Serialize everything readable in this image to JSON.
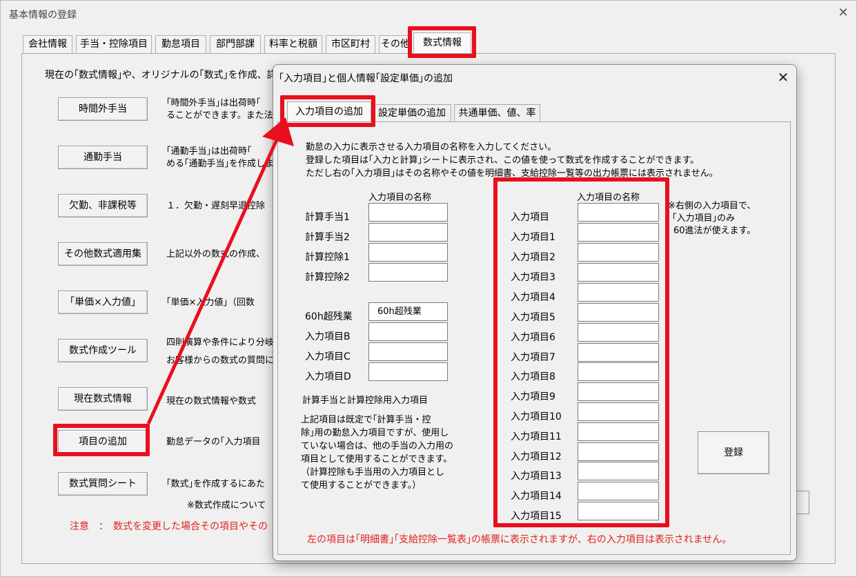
{
  "window": {
    "title": "基本情報の登録",
    "close": "✕"
  },
  "main_tabs": [
    "会社情報",
    "手当・控除項目",
    "勤怠項目",
    "部門部課",
    "料率と税額",
    "市区町村",
    "その他",
    "数式情報"
  ],
  "main": {
    "description": "現在の｢数式情報｣や、オリジナルの｢数式｣を作成、詳",
    "buttons": [
      {
        "label": "時間外手当",
        "desc": [
          "｢時間外手当｣は出荷時｢",
          "ることができます。また法定外"
        ]
      },
      {
        "label": "通勤手当",
        "desc": [
          "｢通勤手当｣は出荷時｢",
          "める｢通勤手当｣を作成しま"
        ]
      },
      {
        "label": "欠勤、非課税等",
        "desc": [
          "１．欠勤・遅刻早退控除"
        ]
      },
      {
        "label": "その他数式適用集",
        "desc": [
          "上記以外の数式の作成、"
        ]
      },
      {
        "label": "｢単価×入力値｣",
        "desc": [
          "｢単価×入力値｣（回数"
        ]
      },
      {
        "label": "数式作成ツール",
        "desc": [
          "四則演算や条件により分岐",
          "お客様からの数式の質問に"
        ]
      },
      {
        "label": "現在数式情報",
        "desc": [
          "現在の数式情報や数式"
        ]
      },
      {
        "label": "項目の追加",
        "desc": [
          "勤怠データの｢入力項目"
        ]
      },
      {
        "label": "数式質問シート",
        "desc": [
          "｢数式｣を作成するにあた"
        ]
      }
    ],
    "note_star": "※数式作成について",
    "note_red": "注意　：　数式を変更した場合その項目やその"
  },
  "dialog": {
    "title": "｢入力項目｣と個人情報｢設定単価｣の追加",
    "close": "✕",
    "tabs": [
      "入力項目の追加",
      "設定単価の追加",
      "共通単価、値、率"
    ],
    "intro": [
      "勤怠の入力に表示させる入力項目の名称を入力してください。",
      "登録した項目は｢入力と計算｣シートに表示され、この値を使って数式を作成することができます。",
      "ただし右の｢入力項目｣はその名称やその値を明細書、支給控除一覧等の出力帳票には表示されません。"
    ],
    "left_header": "入力項目の名称",
    "left_group1": [
      {
        "label": "計算手当1",
        "value": ""
      },
      {
        "label": "計算手当2",
        "value": ""
      },
      {
        "label": "計算控除1",
        "value": ""
      },
      {
        "label": "計算控除2",
        "value": ""
      }
    ],
    "left_group2": [
      {
        "label": "60h超残業",
        "value": "60h超残業"
      },
      {
        "label": "入力項目B",
        "value": ""
      },
      {
        "label": "入力項目C",
        "value": ""
      },
      {
        "label": "入力項目D",
        "value": ""
      }
    ],
    "left_subtitle": "計算手当と計算控除用入力項目",
    "left_paragraph": [
      "上記項目は既定で｢計算手当・控",
      "除｣用の勤怠入力項目ですが、使用し",
      "ていない場合は、他の手当の入力用の",
      "項目として使用することができます。",
      "（計算控除も手当用の入力項目とし",
      "て使用することができます。）"
    ],
    "right_header": "入力項目の名称",
    "right_fields": [
      {
        "label": "入力項目",
        "value": ""
      },
      {
        "label": "入力項目1",
        "value": ""
      },
      {
        "label": "入力項目2",
        "value": ""
      },
      {
        "label": "入力項目3",
        "value": ""
      },
      {
        "label": "入力項目4",
        "value": ""
      },
      {
        "label": "入力項目5",
        "value": ""
      },
      {
        "label": "入力項目6",
        "value": ""
      },
      {
        "label": "入力項目7",
        "value": ""
      },
      {
        "label": "入力項目8",
        "value": ""
      },
      {
        "label": "入力項目9",
        "value": ""
      },
      {
        "label": "入力項目10",
        "value": ""
      },
      {
        "label": "入力項目11",
        "value": ""
      },
      {
        "label": "入力項目12",
        "value": ""
      },
      {
        "label": "入力項目13",
        "value": ""
      },
      {
        "label": "入力項目14",
        "value": ""
      },
      {
        "label": "入力項目15",
        "value": ""
      }
    ],
    "side_note": [
      "※右側の入力項目で、",
      "｢入力項目｣のみ",
      "60進法が使えます。"
    ],
    "register": "登録",
    "bottom_note": "左の項目は｢明細書｣｢支給控除一覧表｣の帳票に表示されますが、右の入力項目は表示されません。"
  },
  "colors": {
    "highlight": "#e8101e",
    "warning_text": "#e0201c"
  }
}
